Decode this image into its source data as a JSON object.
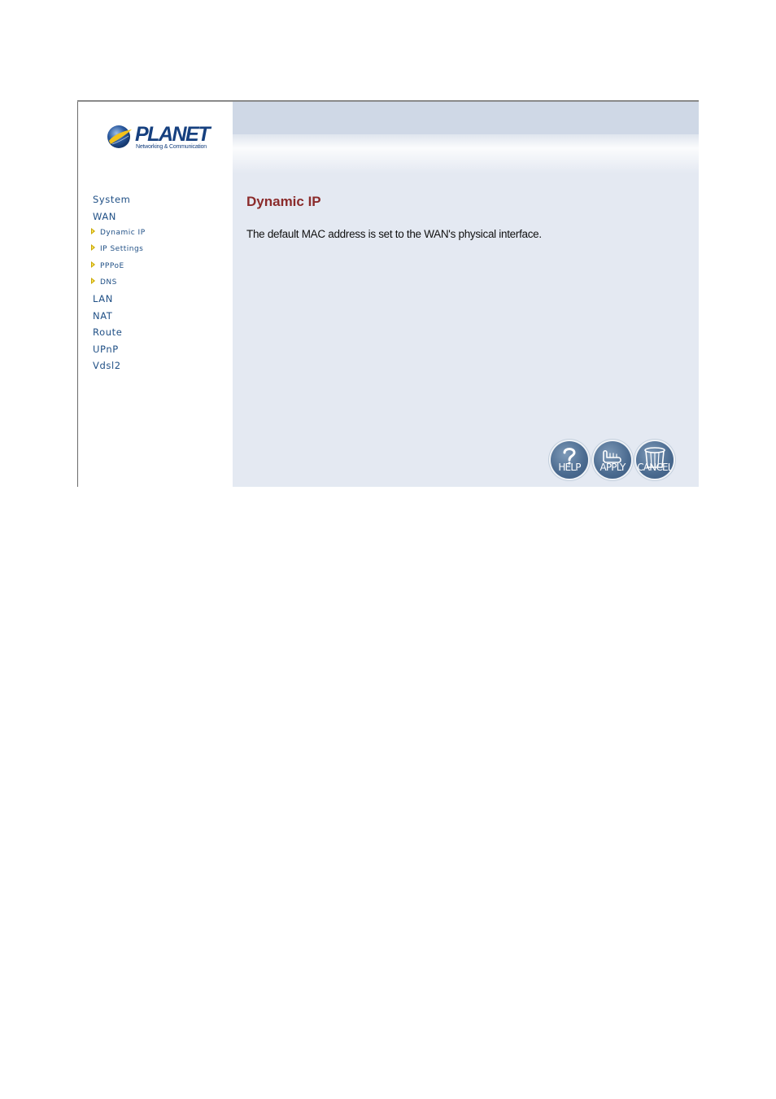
{
  "logo": {
    "name": "PLANET",
    "tagline": "Networking & Communication"
  },
  "sidebar": {
    "items": [
      {
        "label": "System"
      },
      {
        "label": "WAN"
      },
      {
        "label": "LAN"
      },
      {
        "label": "NAT"
      },
      {
        "label": "Route"
      },
      {
        "label": "UPnP"
      },
      {
        "label": "Vdsl2"
      }
    ],
    "wan_subitems": [
      {
        "label": "Dynamic IP"
      },
      {
        "label": "IP Settings"
      },
      {
        "label": "PPPoE"
      },
      {
        "label": "DNS"
      }
    ]
  },
  "main": {
    "title": "Dynamic IP",
    "description": "The default MAC address is set to the WAN's physical interface."
  },
  "buttons": {
    "help": "HELP",
    "apply": "APPLY",
    "cancel": "CANCEL"
  },
  "colors": {
    "title": "#8b2b2b",
    "nav": "#1f4f85",
    "panel": "#e4e9f2",
    "header": "#cfd8e6",
    "bullet": "#c9a800"
  }
}
